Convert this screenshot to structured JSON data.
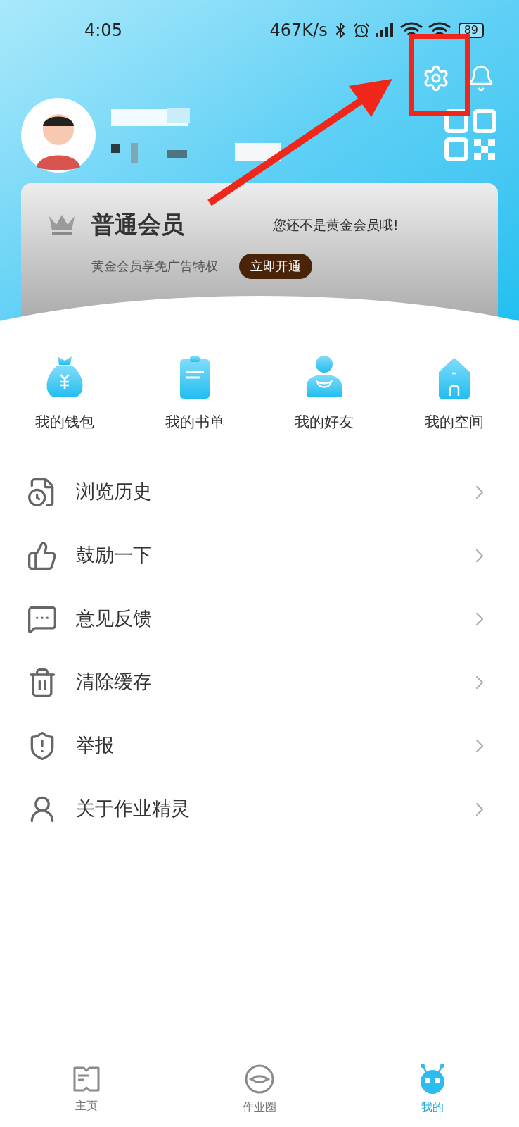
{
  "status_bar": {
    "time": "4:05",
    "speed": "467K/s",
    "battery": "89"
  },
  "member": {
    "title": "普通会员",
    "perk": "黄金会员享免广告特权",
    "note": "您还不是黄金会员哦!",
    "action": "立即开通"
  },
  "shortcuts": [
    {
      "label": "我的钱包"
    },
    {
      "label": "我的书单"
    },
    {
      "label": "我的好友"
    },
    {
      "label": "我的空间"
    }
  ],
  "menu": [
    {
      "label": "浏览历史"
    },
    {
      "label": "鼓励一下"
    },
    {
      "label": "意见反馈"
    },
    {
      "label": "清除缓存"
    },
    {
      "label": "举报"
    },
    {
      "label": "关于作业精灵"
    }
  ],
  "tab_bar": [
    {
      "label": "主页",
      "selected": false
    },
    {
      "label": "作业圈",
      "selected": false
    },
    {
      "label": "我的",
      "selected": true
    }
  ]
}
